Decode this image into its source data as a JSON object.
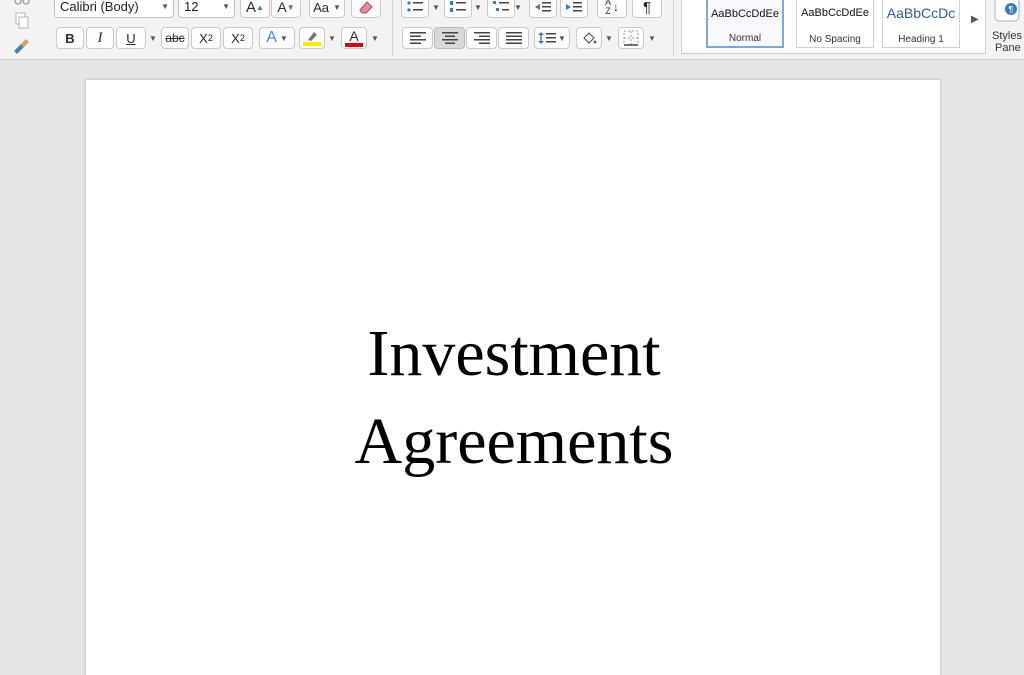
{
  "ribbon": {
    "font_name": "Calibri (Body)",
    "font_size": "12",
    "format": {
      "bold": "B",
      "italic": "I",
      "underline": "U",
      "strikethrough": "abc",
      "subscript_base": "X",
      "subscript_mark": "2",
      "superscript_base": "X",
      "superscript_mark": "2",
      "text_effects": "A",
      "font_color": "A",
      "grow_font": "A",
      "shrink_font": "A",
      "change_case": "Aa",
      "show_formatting": "¶"
    },
    "highlight_color": "#ffeb00",
    "font_color_bar": "#e00000",
    "styles": [
      {
        "preview": "AaBbCcDdEe",
        "label": "Normal"
      },
      {
        "preview": "AaBbCcDdEe",
        "label": "No Spacing"
      },
      {
        "preview": "AaBbCcDc",
        "label": "Heading 1"
      }
    ],
    "styles_pane": {
      "line1": "Styles",
      "line2": "Pane"
    }
  },
  "document": {
    "title_line1": "Investment",
    "title_line2": "Agreements"
  }
}
